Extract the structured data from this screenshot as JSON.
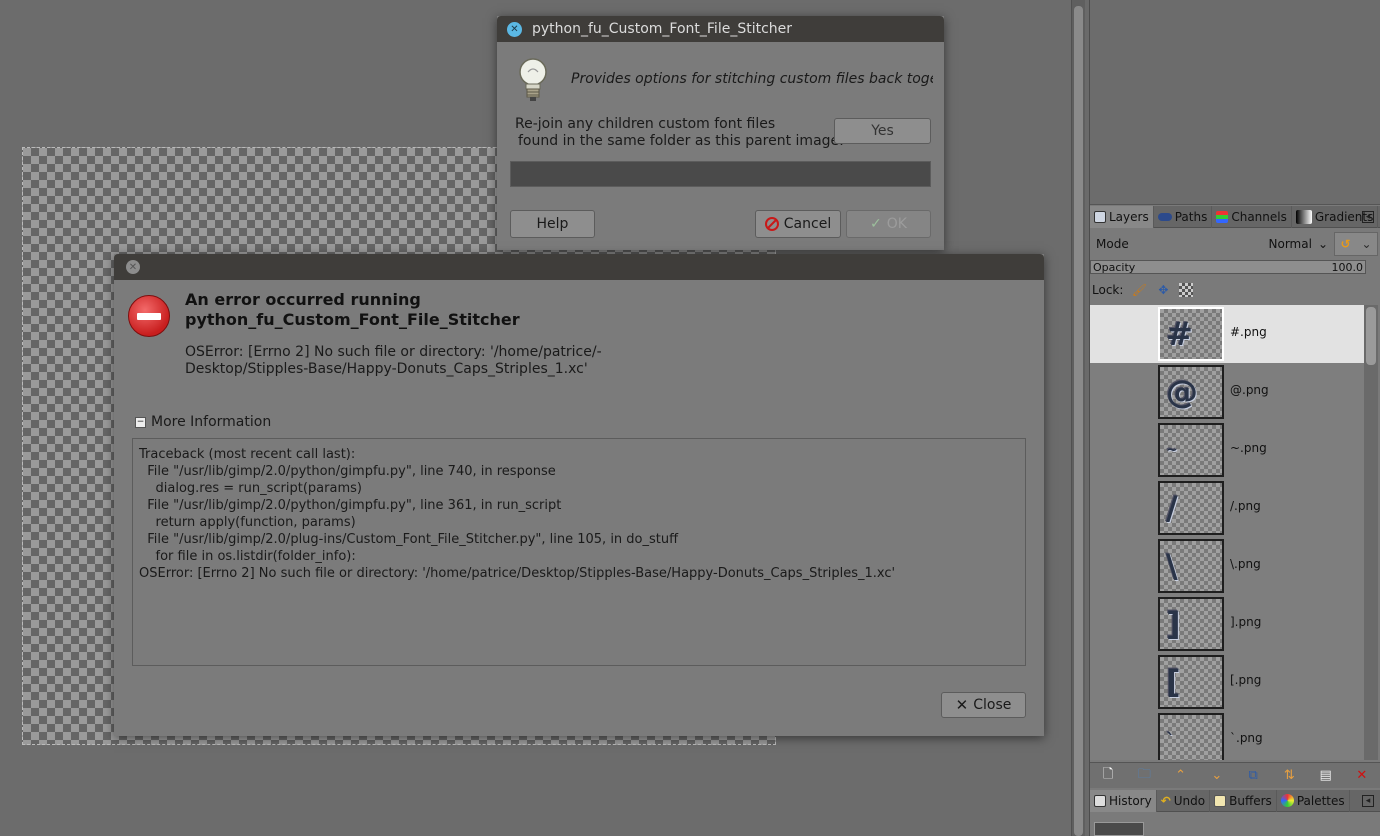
{
  "plugin_dialog": {
    "title": "python_fu_Custom_Font_File_Stitcher",
    "description": "Provides options for stitching custom files back together",
    "rejoin_line1": "Re-join any children custom font files",
    "rejoin_line2": "found in the same folder as this parent image:",
    "yes_label": "Yes",
    "help_label": "Help",
    "cancel_label": "Cancel",
    "ok_label": "OK"
  },
  "error_dialog": {
    "title_line1": "An error occurred running",
    "title_line2": "python_fu_Custom_Font_File_Stitcher",
    "message_line1": "OSError: [Errno 2] No such file or directory: '/home/patrice/-",
    "message_line2": "Desktop/Stipples-Base/Happy-Donuts_Caps_Striples_1.xc'",
    "more_info_label": "More Information",
    "traceback": "Traceback (most recent call last):\n  File \"/usr/lib/gimp/2.0/python/gimpfu.py\", line 740, in response\n    dialog.res = run_script(params)\n  File \"/usr/lib/gimp/2.0/python/gimpfu.py\", line 361, in run_script\n    return apply(function, params)\n  File \"/usr/lib/gimp/2.0/plug-ins/Custom_Font_File_Stitcher.py\", line 105, in do_stuff\n    for file in os.listdir(folder_info):\nOSError: [Errno 2] No such file or directory: '/home/patrice/Desktop/Stipples-Base/Happy-Donuts_Caps_Striples_1.xc'",
    "close_label": "Close"
  },
  "dock": {
    "tabs": [
      {
        "label": "Layers",
        "icon": "layers-icon"
      },
      {
        "label": "Paths",
        "icon": "paths-icon"
      },
      {
        "label": "Channels",
        "icon": "channels-icon"
      },
      {
        "label": "Gradients",
        "icon": "gradients-icon"
      }
    ],
    "mode_label": "Mode",
    "mode_value": "Normal",
    "opacity_label": "Opacity",
    "opacity_value": "100.0",
    "lock_label": "Lock:",
    "layers": [
      {
        "name": "#.png",
        "glyph": "#",
        "selected": true
      },
      {
        "name": "@.png",
        "glyph": "@",
        "selected": false
      },
      {
        "name": "~.png",
        "glyph": "~",
        "selected": false
      },
      {
        "name": "/.png",
        "glyph": "/",
        "selected": false
      },
      {
        "name": "\\.png",
        "glyph": "\\",
        "selected": false
      },
      {
        "name": "].png",
        "glyph": "]",
        "selected": false
      },
      {
        "name": "[.png",
        "glyph": "[",
        "selected": false
      },
      {
        "name": "`.png",
        "glyph": "`",
        "selected": false
      }
    ],
    "bottom_tabs": [
      {
        "label": "History",
        "icon": "history-icon"
      },
      {
        "label": "Undo",
        "icon": "undo-icon"
      },
      {
        "label": "Buffers",
        "icon": "buffers-icon"
      },
      {
        "label": "Palettes",
        "icon": "palettes-icon"
      }
    ]
  }
}
